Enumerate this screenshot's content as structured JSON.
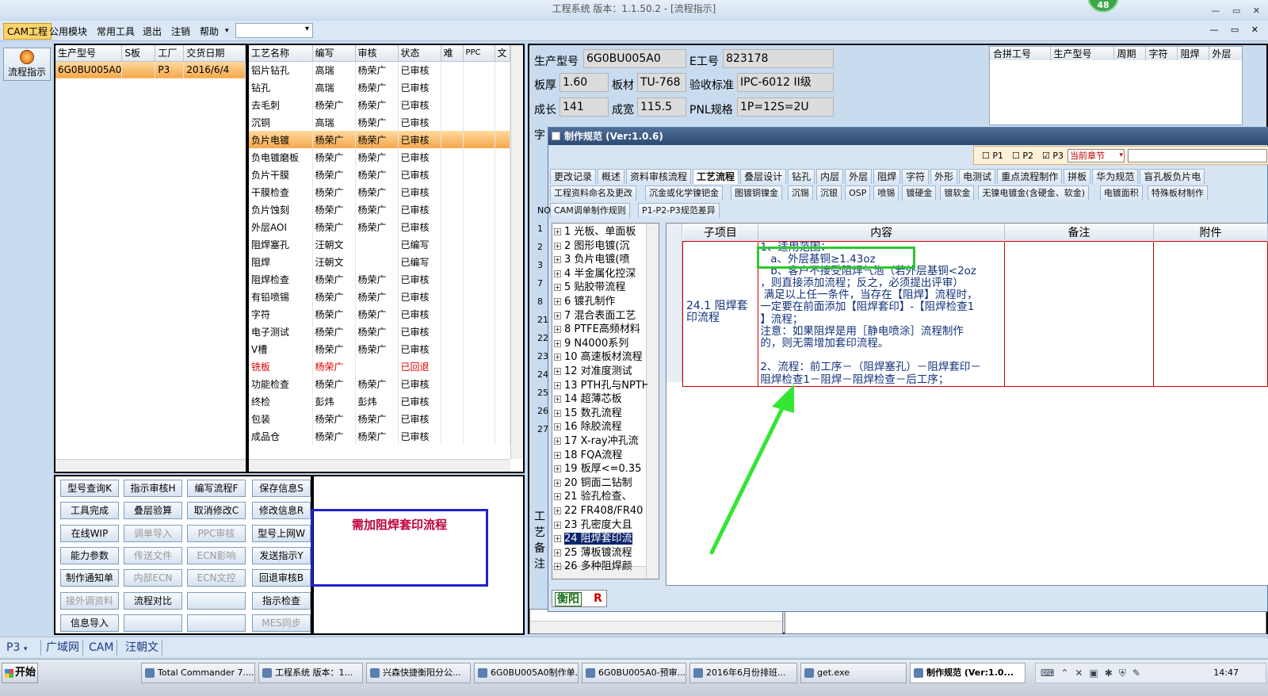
{
  "window": {
    "title": "工程系统  版本：1.1.50.2 - [流程指示]",
    "badge": "48"
  },
  "menu": {
    "items": [
      "CAM工程",
      "公用模块",
      "常用工具",
      "退出",
      "注销",
      "帮助"
    ],
    "combo_value": ""
  },
  "left": {
    "flow_button": "流程指示"
  },
  "job_grid": {
    "columns": [
      "生产型号",
      "S板",
      "工厂",
      "交货日期"
    ],
    "rows": [
      [
        "6G0BU005A0",
        "",
        "P3",
        "2016/6/4"
      ]
    ]
  },
  "process_grid": {
    "columns": [
      "工艺名称",
      "编写",
      "审核",
      "状态",
      "难",
      "PPC",
      "文"
    ],
    "rows": [
      [
        "铝片钻孔",
        "高瑞",
        "杨荣广",
        "已审核"
      ],
      [
        "钻孔",
        "高瑞",
        "杨荣广",
        "已审核"
      ],
      [
        "去毛刺",
        "杨荣广",
        "杨荣广",
        "已审核"
      ],
      [
        "沉铜",
        "高瑞",
        "杨荣广",
        "已审核"
      ],
      [
        "负片电镀",
        "杨荣广",
        "杨荣广",
        "已审核"
      ],
      [
        "负电镀磨板",
        "杨荣广",
        "杨荣广",
        "已审核"
      ],
      [
        "负片干膜",
        "杨荣广",
        "杨荣广",
        "已审核"
      ],
      [
        "干膜检查",
        "杨荣广",
        "杨荣广",
        "已审核"
      ],
      [
        "负片蚀刻",
        "杨荣广",
        "杨荣广",
        "已审核"
      ],
      [
        "外层AOI",
        "杨荣广",
        "杨荣广",
        "已审核"
      ],
      [
        "阻焊塞孔",
        "汪朝文",
        "",
        "已编写"
      ],
      [
        "阻焊",
        "汪朝文",
        "",
        "已编写"
      ],
      [
        "阻焊检查",
        "杨荣广",
        "杨荣广",
        "已审核"
      ],
      [
        "有铅喷锡",
        "杨荣广",
        "杨荣广",
        "已审核"
      ],
      [
        "字符",
        "杨荣广",
        "杨荣广",
        "已审核"
      ],
      [
        "电子测试",
        "杨荣广",
        "杨荣广",
        "已审核"
      ],
      [
        "V槽",
        "杨荣广",
        "杨荣广",
        "已审核"
      ],
      [
        "铣板",
        "杨荣广",
        "",
        "已回退"
      ],
      [
        "功能检查",
        "杨荣广",
        "杨荣广",
        "已审核"
      ],
      [
        "终检",
        "彭炜",
        "彭炜",
        "已审核"
      ],
      [
        "包装",
        "杨荣广",
        "杨荣广",
        "已审核"
      ],
      [
        "成品仓",
        "杨荣广",
        "杨荣广",
        "已审核"
      ]
    ]
  },
  "buttons": [
    [
      "型号查询K",
      "指示审核H",
      "编写流程F",
      "保存信息S"
    ],
    [
      "工具完成",
      "叠层验算",
      "取消修改C",
      "修改信息R"
    ],
    [
      "在线WIP",
      "调单导入",
      "PPC审核",
      "型号上网W"
    ],
    [
      "能力参数",
      "传送文件",
      "ECN影响",
      "发送指示Y"
    ],
    [
      "制作通知单",
      "内部ECN",
      "ECN文控",
      "回退审核B"
    ],
    [
      "接外调资料",
      "流程对比",
      "",
      "指示检查"
    ],
    [
      "信息导入",
      "",
      "",
      "MES同步"
    ]
  ],
  "note": {
    "text": "需加阻焊套印流程"
  },
  "info": {
    "model_label": "生产型号",
    "model": "6G0BU005A0",
    "eno_label": "E工号",
    "eno": "823178",
    "thick_label": "板厚",
    "thick": "1.60",
    "mat_label": "板材",
    "mat": "TU-768",
    "std_label": "验收标准",
    "std": "IPC-6012 II级",
    "len_label": "成长",
    "len": "141",
    "wid_label": "成宽",
    "wid": "115.5",
    "pnl_label": "PNL规格",
    "pnl": "1P=12S=2U",
    "char_label": "字",
    "remark_label": "工艺备注"
  },
  "merge_grid": {
    "columns": [
      "合拼工号",
      "生产型号",
      "周期",
      "字符",
      "阻焊",
      "外层"
    ]
  },
  "dialog": {
    "title": "制作规范 (Ver:1.0.6)",
    "filters": {
      "p1": "P1",
      "p2": "P2",
      "p3": "P3",
      "chapter": "当前章节"
    },
    "tabs_row1": [
      "更改记录",
      "概述",
      "资料审核流程",
      "工艺流程",
      "叠层设计",
      "钻孔",
      "内层",
      "外层",
      "阻焊",
      "字符",
      "外形",
      "电测试",
      "重点流程制作",
      "拼板",
      "华为规范",
      "盲孔板负片电"
    ],
    "tabs_row2": [
      "工程资料命名及更改",
      "沉金或化学镍钯金",
      "图镀铜镍金",
      "沉锡",
      "沉银",
      "OSP",
      "喷锡",
      "镀硬金",
      "镀软金",
      "无镍电镀金(含硬金、软金)",
      "电镀面积",
      "特殊板材制作"
    ],
    "tabs_row3": [
      "CAM调单制作规则",
      "P1-P2-P3规范差异"
    ],
    "tree": [
      "1 光板、单面板",
      "2 图形电镀(沉",
      "3 负片电镀(喷",
      "4 半金属化控深",
      "5 贴胶带流程",
      "6 镀孔制作",
      "7 混合表面工艺",
      "8 PTFE高频材料",
      "9 N4000系列",
      "10 高速板材流程",
      "12 对准度测试",
      "13 PTH孔与NPTH",
      "14 超薄芯板",
      "15 数孔流程",
      "16 除胶流程",
      "17 X-ray冲孔流",
      "18 FQA流程",
      "19 板厚<=0.35",
      "20 铜面二钻制",
      "21 验孔检查、",
      "22 FR408/FR40",
      "23 孔密度大且",
      "24 阻焊套印流",
      "25 薄板镀流程",
      "26 多种阻焊颜"
    ],
    "tree_selected": 22,
    "row_numbers": [
      "NO",
      "1",
      "2",
      "3",
      "7",
      "8",
      "21",
      "22",
      "23",
      "24",
      "25",
      "26",
      "27"
    ],
    "table": {
      "columns": [
        "子项目",
        "内容",
        "备注",
        "附件"
      ],
      "sub": "24.1 阻焊套印流程",
      "content": [
        "1、适用范围：",
        "   a、外层基铜≥1.43oz",
        "   b、客户不接受阻焊气泡（若外层基铜<2oz",
        "，则直接添加流程；反之，必须提出评审）",
        " 满足以上任一条件，当存在【阻焊】流程时，",
        "一定要在前面添加【阻焊套印】-【阻焊检查1",
        "】流程；",
        "注意：如果阻焊是用［静电喷涂］流程制作",
        "的，则无需增加套印流程。",
        "",
        "2、流程：前工序－（阻焊塞孔）－阻焊套印－",
        "阻焊检查1－阻焊－阻焊检查－后工序；"
      ]
    },
    "bottom": {
      "left": "衡阳",
      "right": "R"
    }
  },
  "status": {
    "items": [
      "P3",
      "广域网",
      "CAM",
      "汪朝文"
    ]
  },
  "taskbar": {
    "start": "开始",
    "tasks": [
      "Total Commander 7....",
      "工程系统  版本：1...",
      "兴森快捷衡阳分公...",
      "6G0BU005A0制作单...",
      "6G0BU005A0-预审...",
      "2016年6月份排班...",
      "get.exe",
      "制作规范 (Ver:1.0..."
    ],
    "clock": "14:47"
  }
}
